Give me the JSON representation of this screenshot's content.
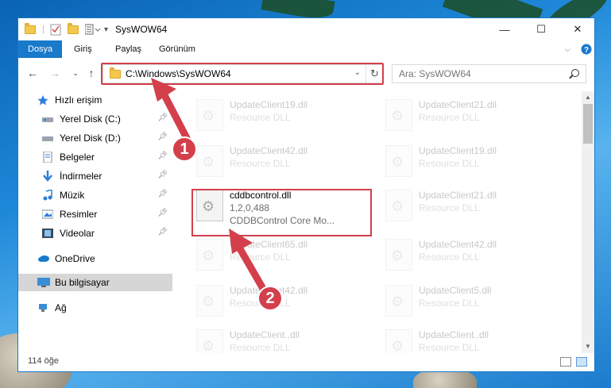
{
  "window": {
    "title": "SysWOW64"
  },
  "ribbon": {
    "tabs": [
      "Dosya",
      "Giriş",
      "Paylaş",
      "Görünüm"
    ]
  },
  "address": {
    "path": "C:\\Windows\\SysWOW64"
  },
  "search": {
    "placeholder": "Ara: SysWOW64"
  },
  "sidebar": {
    "items": [
      {
        "label": "Hızlı erişim"
      },
      {
        "label": "Yerel Disk (C:)"
      },
      {
        "label": "Yerel Disk (D:)"
      },
      {
        "label": "Belgeler"
      },
      {
        "label": "İndirmeler"
      },
      {
        "label": "Müzik"
      },
      {
        "label": "Resimler"
      },
      {
        "label": "Videolar"
      },
      {
        "label": "OneDrive"
      },
      {
        "label": "Bu bilgisayar"
      },
      {
        "label": "Ağ"
      }
    ]
  },
  "files": [
    {
      "name": "UpdateClient19.dll",
      "type": "Resource DLL"
    },
    {
      "name": "UpdateClient21.dll",
      "type": "Resource DLL"
    },
    {
      "name": "UpdateClient42.dll",
      "type": "Resource DLL"
    },
    {
      "name": "UpdateClient19.dll",
      "type": "Resource DLL"
    },
    {
      "name": "cddbcontrol.dll",
      "version": "1,2,0,488",
      "description": "CDDBControl Core Mo..."
    },
    {
      "name": "UpdateClient21.dll",
      "type": "Resource DLL"
    },
    {
      "name": "UpdateClient65.dll",
      "type": "Resource DLL"
    },
    {
      "name": "UpdateClient42.dll",
      "type": "Resource DLL"
    },
    {
      "name": "UpdateClient42.dll",
      "type": "Resource DLL"
    },
    {
      "name": "UpdateClient5.dll",
      "type": "Resource DLL"
    },
    {
      "name": "UpdateClient..dll",
      "type": "Resource DLL"
    },
    {
      "name": "UpdateClient..dll",
      "type": "Resource DLL"
    }
  ],
  "status": {
    "count": "114 öğe"
  },
  "callouts": [
    "1",
    "2"
  ]
}
